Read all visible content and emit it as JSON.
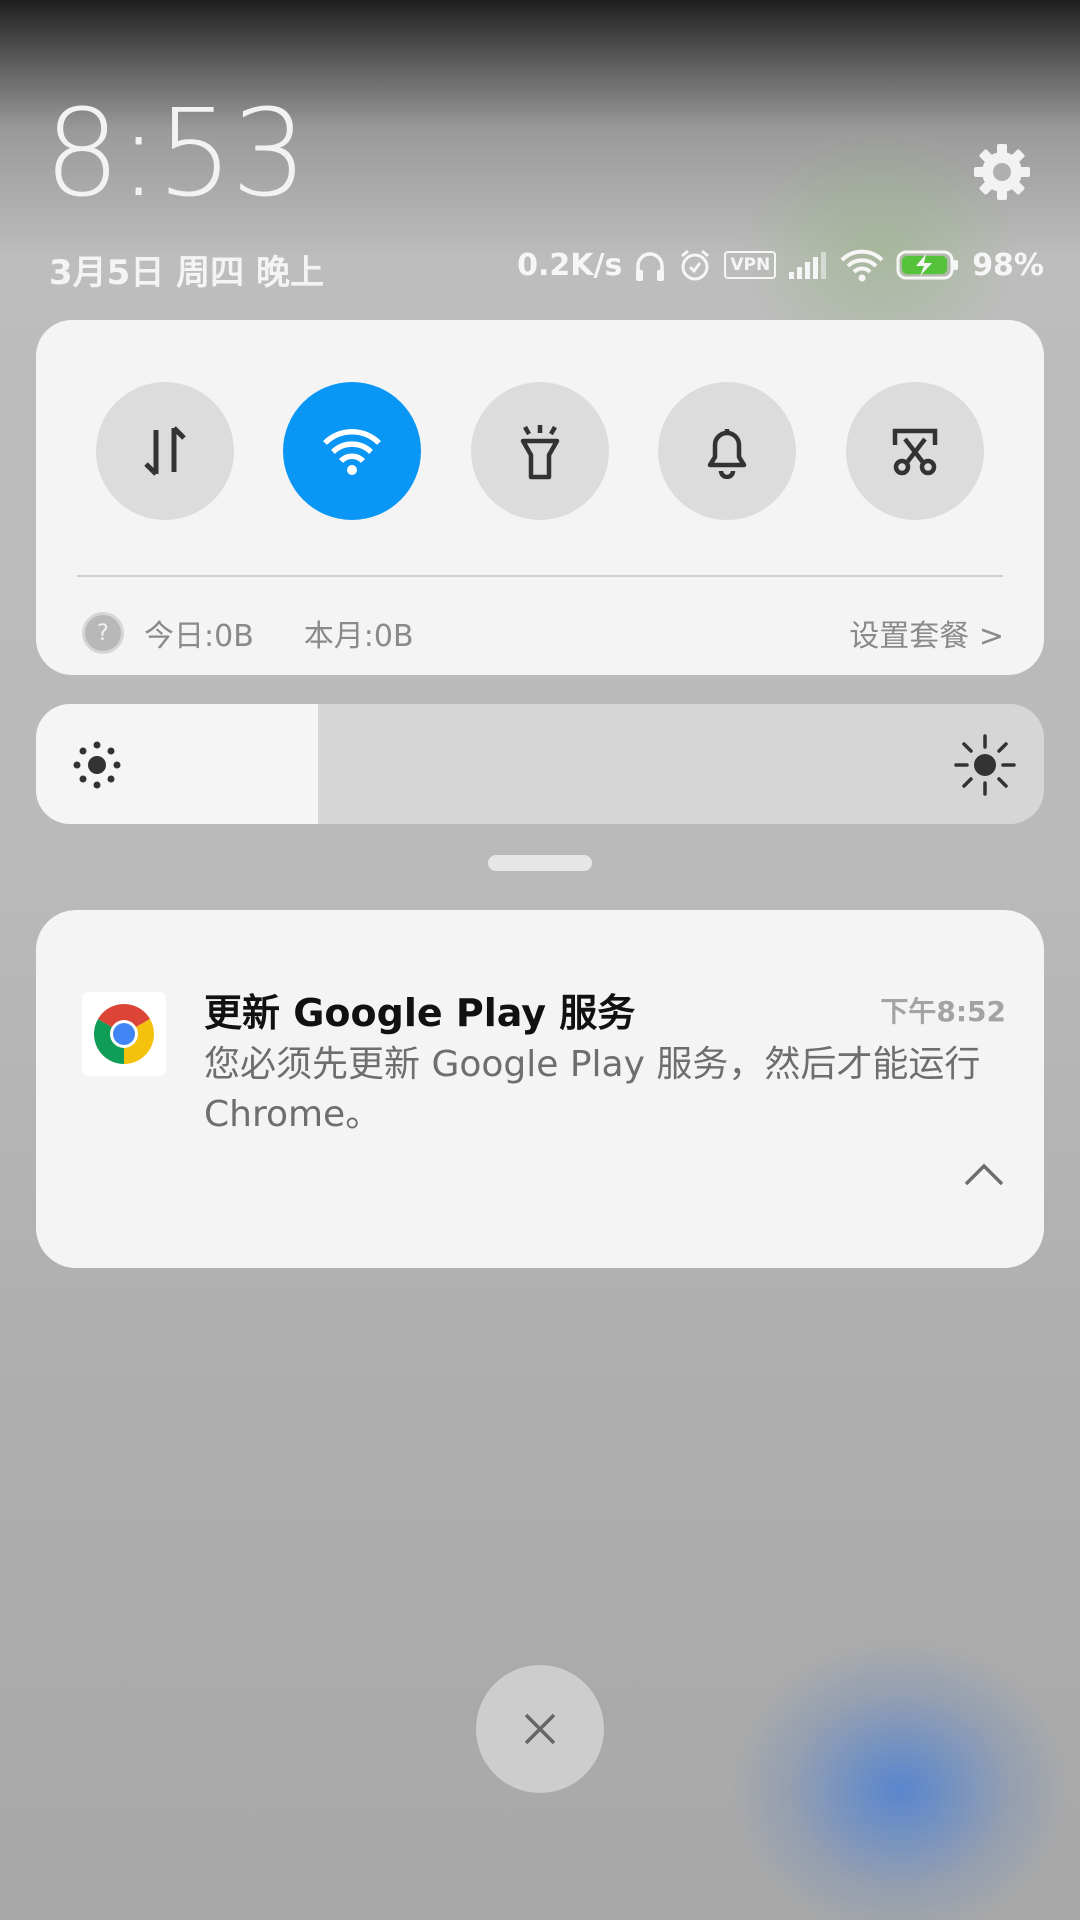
{
  "header": {
    "time": "8:53",
    "date": "3月5日 周四 晚上",
    "settings_icon": "gear-icon"
  },
  "status_bar": {
    "net_speed": "0.2K/s",
    "vpn_label": "VPN",
    "battery_percent": "98%",
    "battery_level": 0.98,
    "icons": [
      "headphones-icon",
      "alarm-icon",
      "vpn-icon",
      "signal-icon",
      "wifi-icon",
      "battery-charging-icon"
    ]
  },
  "quick_settings": {
    "toggles": [
      {
        "name": "mobile-data",
        "icon": "data-arrows-icon",
        "active": false
      },
      {
        "name": "wifi",
        "icon": "wifi-icon",
        "active": true
      },
      {
        "name": "flashlight",
        "icon": "flashlight-icon",
        "active": false
      },
      {
        "name": "sound",
        "icon": "bell-icon",
        "active": false
      },
      {
        "name": "screenshot",
        "icon": "scissors-icon",
        "active": false
      }
    ],
    "data_usage": {
      "help_glyph": "?",
      "today": "今日:0B",
      "month": "本月:0B",
      "setup_link": "设置套餐 >"
    }
  },
  "brightness": {
    "level": 0.28
  },
  "notification": {
    "app_icon": "chrome-icon",
    "title": "更新 Google Play 服务",
    "time": "下午8:52",
    "body": "您必须先更新 Google Play 服务，然后才能运行 Chrome。"
  },
  "clear_button_glyph": "×",
  "colors": {
    "accent": "#0a96f4",
    "card_background": "#f4f4f4",
    "toggle_inactive": "#dcdcdc"
  }
}
